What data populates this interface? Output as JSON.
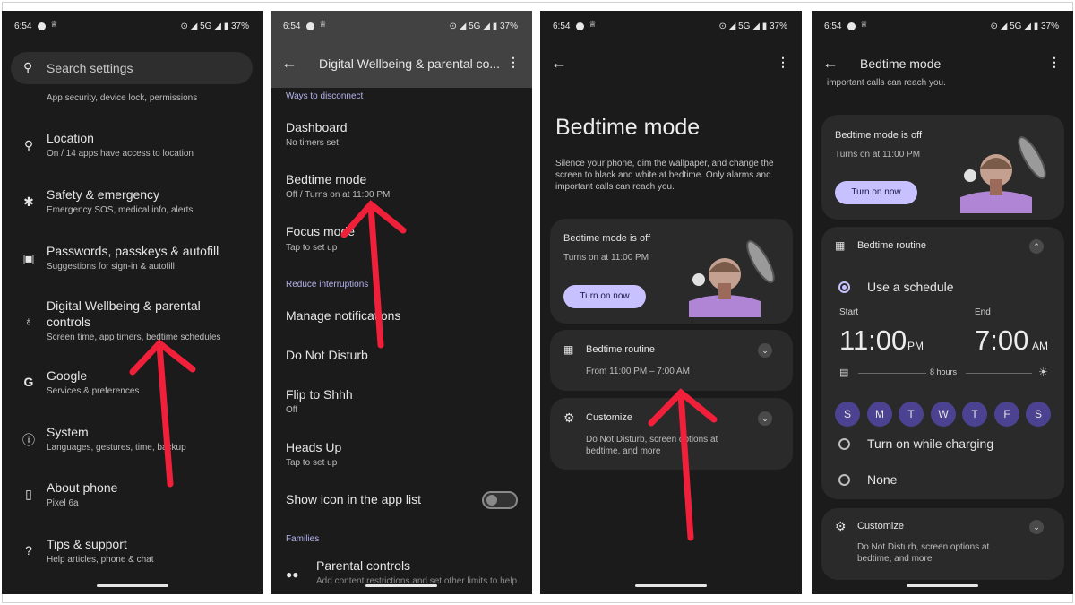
{
  "status": {
    "time": "6:54",
    "crown": "♕",
    "right": "⊙ ◢ 5G ◢ ▮ 37%"
  },
  "panel1": {
    "search_placeholder": "Search settings",
    "clipped_sub": "App security, device lock, permissions",
    "items": [
      {
        "icon": "⚲",
        "title": "Location",
        "sub": "On / 14 apps have access to location"
      },
      {
        "icon": "✱",
        "title": "Safety & emergency",
        "sub": "Emergency SOS, medical info, alerts"
      },
      {
        "icon": "▣",
        "title": "Passwords, passkeys & autofill",
        "sub": "Suggestions for sign-in & autofill"
      },
      {
        "icon": "♁",
        "title1": "Digital Wellbeing & parental",
        "title2": "controls",
        "sub": "Screen time, app timers, bedtime schedules"
      },
      {
        "icon": "G",
        "title": "Google",
        "sub": "Services & preferences"
      },
      {
        "icon": "ⓘ",
        "title": "System",
        "sub": "Languages, gestures, time, backup"
      },
      {
        "icon": "▯",
        "title": "About phone",
        "sub": "Pixel 6a"
      },
      {
        "icon": "?",
        "title": "Tips & support",
        "sub": "Help articles, phone & chat"
      }
    ]
  },
  "panel2": {
    "title": "Digital Wellbeing & parental co...",
    "section1": "Ways to disconnect",
    "items1": [
      {
        "title": "Dashboard",
        "sub": "No timers set"
      },
      {
        "title": "Bedtime mode",
        "sub": "Off / Turns on at 11:00 PM"
      },
      {
        "title": "Focus mode",
        "sub": "Tap to set up"
      }
    ],
    "section2": "Reduce interruptions",
    "items2": [
      {
        "title": "Manage notifications"
      },
      {
        "title": "Do Not Disturb"
      },
      {
        "title": "Flip to Shhh",
        "sub": "Off"
      },
      {
        "title": "Heads Up",
        "sub": "Tap to set up"
      },
      {
        "title": "Show icon in the app list"
      }
    ],
    "section3": "Families",
    "parental_title": "Parental controls",
    "parental_sub": "Add content restrictions and set other limits to help"
  },
  "panel3": {
    "heading": "Bedtime mode",
    "desc": "Silence your phone, dim the wallpaper, and change the screen to black and white at bedtime. Only alarms and important calls can reach you.",
    "card_title": "Bedtime mode is off",
    "card_sub": "Turns on at 11:00 PM",
    "button": "Turn on now",
    "routine_title": "Bedtime routine",
    "routine_sub": "From 11:00 PM – 7:00 AM",
    "customize_title": "Customize",
    "customize_sub": "Do Not Disturb, screen options at bedtime, and more"
  },
  "panel4": {
    "title": "Bedtime mode",
    "clipped_desc": "important calls can reach you.",
    "card_title": "Bedtime mode is off",
    "card_sub": "Turns on at 11:00 PM",
    "button": "Turn on now",
    "routine_title": "Bedtime routine",
    "use_schedule": "Use a schedule",
    "start_label": "Start",
    "end_label": "End",
    "start_time": "11:00",
    "start_ampm": "PM",
    "end_time": "7:00",
    "end_ampm": "AM",
    "duration": "8 hours",
    "days": [
      "S",
      "M",
      "T",
      "W",
      "T",
      "F",
      "S"
    ],
    "charging": "Turn on while charging",
    "none": "None",
    "customize_title": "Customize",
    "customize_sub1": "Do Not Disturb, screen options at",
    "customize_sub2": "bedtime, and more"
  },
  "colors": {
    "accent": "#c7c1ff",
    "day_chip": "#4b4391",
    "arrow": "#f0203a",
    "card": "#2a2a2a",
    "bg": "#1b1b1b"
  }
}
